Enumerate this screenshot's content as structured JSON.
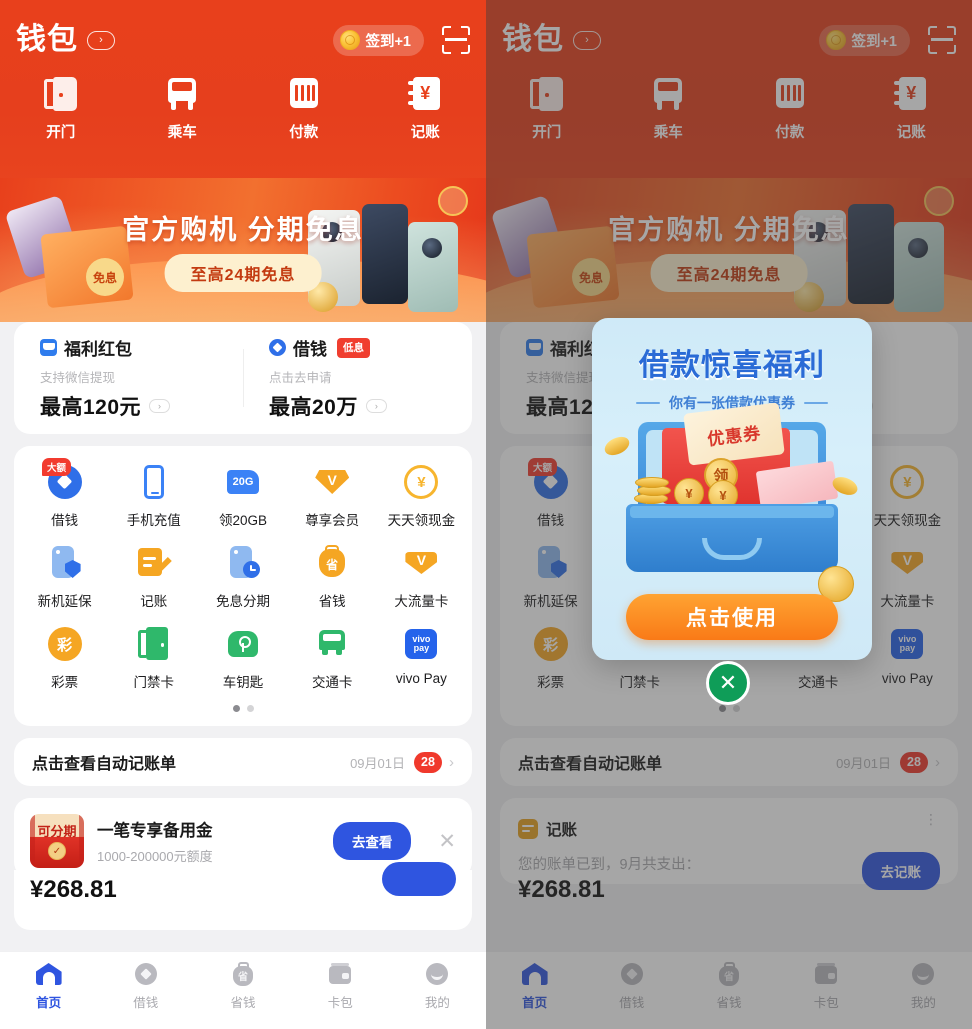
{
  "header": {
    "title": "钱包",
    "title_chevron": "›",
    "signin_label": "签到+1",
    "coin_icon": "gold-coin-icon",
    "scan_icon": "scan-icon"
  },
  "quick_actions": [
    {
      "label": "开门",
      "icon": "door-icon"
    },
    {
      "label": "乘车",
      "icon": "bus-icon"
    },
    {
      "label": "付款",
      "icon": "barcode-icon"
    },
    {
      "label": "记账",
      "icon": "ledger-icon"
    }
  ],
  "banner": {
    "title": "官方购机 分期免息",
    "pill": "至高24期免息",
    "tag": "免息"
  },
  "promo": [
    {
      "icon": "red-envelope-icon",
      "name": "福利红包",
      "badge": "",
      "sub": "支持微信提现",
      "amount": "最高120元",
      "chevron": "›"
    },
    {
      "icon": "loan-diamond-icon",
      "name": "借钱",
      "badge": "低息",
      "sub": "点击去申请",
      "amount": "最高20万",
      "chevron": "›"
    }
  ],
  "grid": {
    "items": [
      {
        "label": "借钱",
        "icon": "loan-diamond-icon",
        "badge": "大额"
      },
      {
        "label": "手机充值",
        "icon": "phone-recharge-icon",
        "badge": ""
      },
      {
        "label": "领20GB",
        "icon": "sim-20g-icon",
        "badge": "",
        "icon_text": "20G"
      },
      {
        "label": "尊享会员",
        "icon": "vip-gem-icon",
        "badge": "",
        "icon_text": "V"
      },
      {
        "label": "天天领现金",
        "icon": "yuan-coin-icon",
        "badge": "",
        "icon_text": "¥"
      },
      {
        "label": "新机延保",
        "icon": "warranty-shield-icon",
        "badge": ""
      },
      {
        "label": "记账",
        "icon": "note-pen-icon",
        "badge": ""
      },
      {
        "label": "免息分期",
        "icon": "installment-clock-icon",
        "badge": ""
      },
      {
        "label": "省钱",
        "icon": "savings-bag-icon",
        "badge": "",
        "icon_text": "省"
      },
      {
        "label": "大流量卡",
        "icon": "data-card-icon",
        "badge": "",
        "icon_text": "V"
      },
      {
        "label": "彩票",
        "icon": "lottery-icon",
        "badge": "",
        "icon_text": "彩"
      },
      {
        "label": "门禁卡",
        "icon": "access-card-icon",
        "badge": ""
      },
      {
        "label": "车钥匙",
        "icon": "car-key-icon",
        "badge": ""
      },
      {
        "label": "交通卡",
        "icon": "transit-card-icon",
        "badge": ""
      },
      {
        "label": "vivo Pay",
        "icon": "vivo-pay-icon",
        "badge": "",
        "icon_text_1": "vivo",
        "icon_text_2": "pay"
      }
    ],
    "pager": {
      "total": 2,
      "active": 1
    }
  },
  "ledger_row": {
    "title": "点击查看自动记账单",
    "date": "09月01日",
    "count": "28",
    "chevron": "›"
  },
  "loan_card": {
    "thumb_text": "可分期",
    "thumb_seal": "✓",
    "title": "一笔专享备用金",
    "subtitle": "1000-200000元额度",
    "button": "去查看",
    "close": "✕",
    "clipped_amount": "¥268.81"
  },
  "account_card": {
    "icon": "ledger-icon",
    "name": "记账",
    "subtitle": "您的账单已到，9月共支出：",
    "button": "去记账",
    "amount": "¥268.81",
    "more": "⋮"
  },
  "tabs": [
    {
      "label": "首页",
      "icon": "home-icon",
      "active": true
    },
    {
      "label": "借钱",
      "icon": "loan-icon",
      "active": false
    },
    {
      "label": "省钱",
      "icon": "savings-icon",
      "active": false
    },
    {
      "label": "卡包",
      "icon": "wallet-icon",
      "active": false
    },
    {
      "label": "我的",
      "icon": "profile-icon",
      "active": false
    }
  ],
  "modal": {
    "title": "借款惊喜福利",
    "subtitle": "你有一张借款优惠券",
    "coupon_text": "优惠券",
    "seal_text": "领",
    "button": "点击使用",
    "close_icon": "close-icon",
    "close_glyph": "✕"
  },
  "colors": {
    "brand_red": "#e8401c",
    "accent_blue": "#2f55e0",
    "badge_red": "#f0392c",
    "orange": "#f5a623",
    "green": "#2fb86b",
    "modal_blue": "#2a6bd6"
  }
}
